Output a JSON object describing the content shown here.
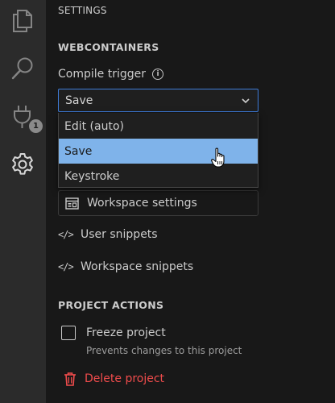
{
  "activity_bar": {
    "icons": [
      "files-icon",
      "search-icon",
      "plug-icon",
      "gear-icon"
    ],
    "plug_badge": "1"
  },
  "panel": {
    "title": "SETTINGS"
  },
  "webcontainers": {
    "header": "WEBCONTAINERS",
    "compile_trigger_label": "Compile trigger",
    "selected_value": "Save",
    "options": [
      "Edit (auto)",
      "Save",
      "Keystroke"
    ],
    "highlighted_option": "Save"
  },
  "links": {
    "workspace_settings": "Workspace settings",
    "user_snippets": "User snippets",
    "workspace_snippets": "Workspace snippets"
  },
  "project_actions": {
    "header": "PROJECT ACTIONS",
    "freeze_label": "Freeze project",
    "freeze_desc": "Prevents changes to this project",
    "freeze_checked": false,
    "delete_label": "Delete project"
  },
  "colors": {
    "accent_border": "#3e7bd7",
    "selected_option_bg": "#7fb3ea",
    "danger": "#f14c4c"
  }
}
